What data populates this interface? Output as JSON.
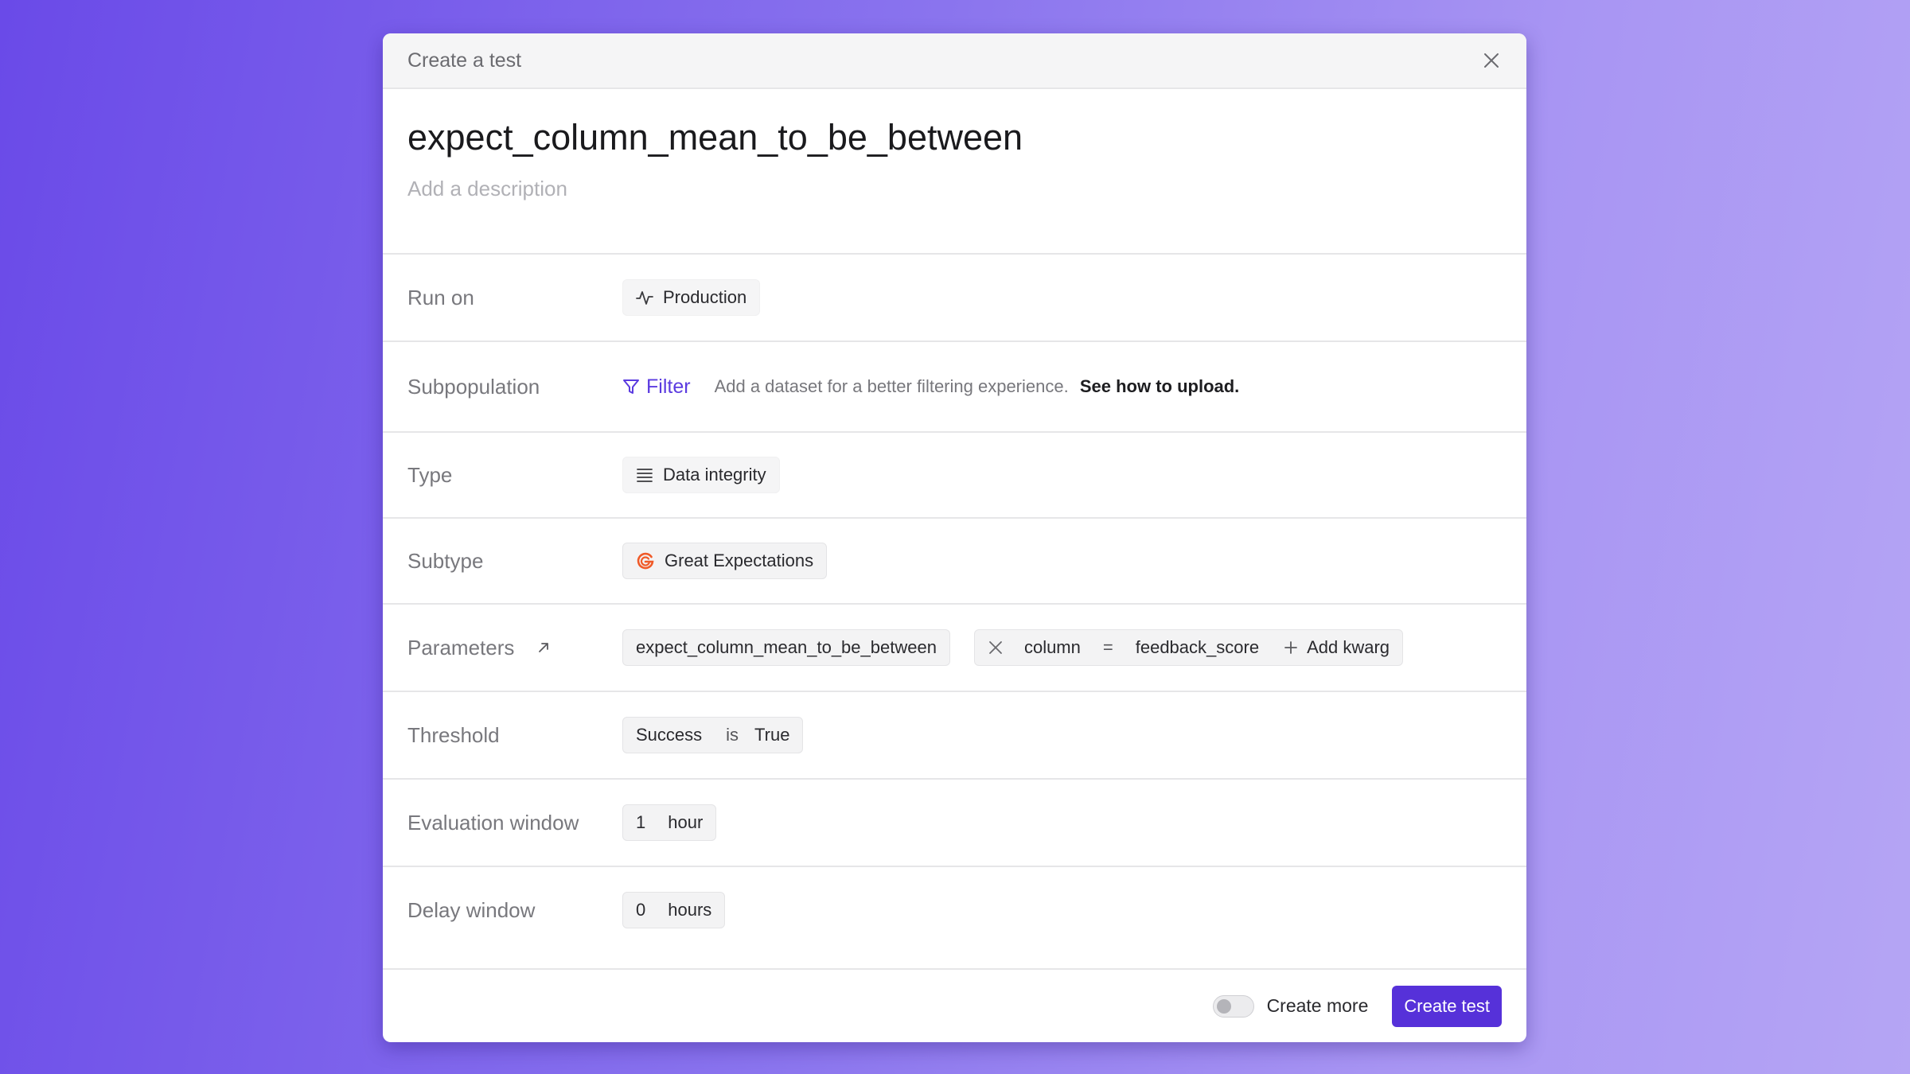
{
  "modal": {
    "title": "Create a test",
    "test_name": "expect_column_mean_to_be_between",
    "description_placeholder": "Add a description"
  },
  "rows": {
    "run_on": {
      "label": "Run on",
      "value": "Production",
      "icon": "activity-icon"
    },
    "subpopulation": {
      "label": "Subpopulation",
      "filter_label": "Filter",
      "help_text": "Add a dataset for a better filtering experience.",
      "help_link": "See how to upload."
    },
    "type": {
      "label": "Type",
      "value": "Data integrity",
      "icon": "list-icon"
    },
    "subtype": {
      "label": "Subtype",
      "value": "Great Expectations",
      "icon": "great-expectations-logo"
    },
    "parameters": {
      "label": "Parameters",
      "expectation": "expect_column_mean_to_be_between",
      "kwarg_key": "column",
      "kwarg_op": "=",
      "kwarg_value": "feedback_score",
      "add_kwarg_label": "Add kwarg"
    },
    "threshold": {
      "label": "Threshold",
      "metric": "Success",
      "operator": "is",
      "value": "True"
    },
    "evaluation_window": {
      "label": "Evaluation window",
      "amount": "1",
      "unit": "hour"
    },
    "delay_window": {
      "label": "Delay window",
      "amount": "0",
      "unit": "hours"
    }
  },
  "footer": {
    "create_more_label": "Create more",
    "create_more_enabled": false,
    "create_button_label": "Create test"
  },
  "colors": {
    "accent": "#5631d9",
    "link": "#5b3be0",
    "great_expectations_orange": "#f05a28"
  }
}
